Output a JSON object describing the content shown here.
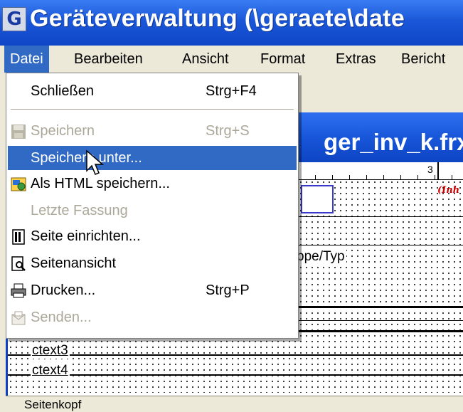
{
  "window": {
    "title": "Geräteverwaltung (\\geraete\\date"
  },
  "menubar": {
    "items": [
      "Datei",
      "Bearbeiten",
      "Ansicht",
      "Format",
      "Extras",
      "Bericht"
    ]
  },
  "file_menu": {
    "items": [
      {
        "label": "Schließen",
        "shortcut": "Strg+F4",
        "disabled": false,
        "icon": ""
      },
      {
        "label": "Speichern",
        "shortcut": "Strg+S",
        "disabled": true,
        "icon": "save-icon"
      },
      {
        "label": "Speichern unter...",
        "shortcut": "",
        "disabled": false,
        "icon": "",
        "highlighted": true
      },
      {
        "label": "Als HTML speichern...",
        "shortcut": "",
        "disabled": false,
        "icon": "html-save-icon"
      },
      {
        "label": "Letzte Fassung",
        "shortcut": "",
        "disabled": true,
        "icon": ""
      },
      {
        "label": "Seite einrichten...",
        "shortcut": "",
        "disabled": false,
        "icon": "page-setup-icon"
      },
      {
        "label": "Seitenansicht",
        "shortcut": "",
        "disabled": false,
        "icon": "print-preview-icon"
      },
      {
        "label": "Drucken...",
        "shortcut": "Strg+P",
        "disabled": false,
        "icon": "printer-icon"
      },
      {
        "label": "Senden...",
        "shortcut": "",
        "disabled": true,
        "icon": "send-mail-icon"
      }
    ]
  },
  "report_window": {
    "title": "ger_inv_k.frx",
    "ruler_number": "3",
    "red_label": "(Inh",
    "field_label": "ppe/Typ",
    "fields": [
      "ctext3",
      "ctext4"
    ],
    "band_label": "Seitenkopf"
  },
  "colors": {
    "titlebar": "#1a57d8",
    "menu_highlight": "#316ac5",
    "disabled_text": "#aca899"
  }
}
